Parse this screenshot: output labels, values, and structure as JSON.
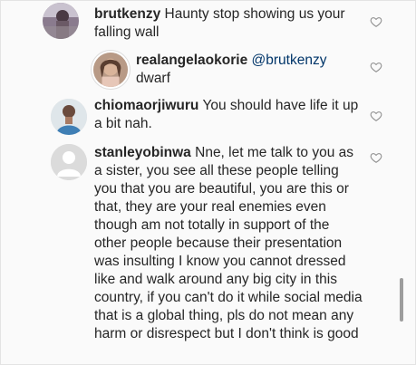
{
  "comments": [
    {
      "username": "brutkenzy",
      "text": "Haunty stop showing us your falling wall",
      "mention": "",
      "avatar_icon": "avatar-photo-person",
      "like_icon": "heart-outline-icon"
    },
    {
      "username": "realangelaokorie",
      "mention": "@brutkenzy",
      "text": "dwarf",
      "avatar_icon": "avatar-photo-woman",
      "like_icon": "heart-outline-icon"
    },
    {
      "username": "chiomaorjiwuru",
      "text": "You should have life it up a bit nah.",
      "mention": "",
      "avatar_icon": "avatar-photo-person",
      "like_icon": "heart-outline-icon"
    },
    {
      "username": "stanleyobinwa",
      "text": "Nne, let me talk to you as a sister, you see all these people telling you that you are beautiful, you are this or that, they are your real enemies even though am not totally in support of the other people because their presentation was insulting I know you cannot dressed like and walk around any big city in this country, if you can't do it while social media that is a global thing, pls do not mean any harm or disrespect but I don't think is good",
      "mention": "",
      "avatar_icon": "default-avatar-icon",
      "like_icon": "heart-outline-icon"
    }
  ],
  "colors": {
    "text": "#262626",
    "mention": "#003569",
    "heart": "#8e8e8e",
    "background": "#fafafa"
  }
}
